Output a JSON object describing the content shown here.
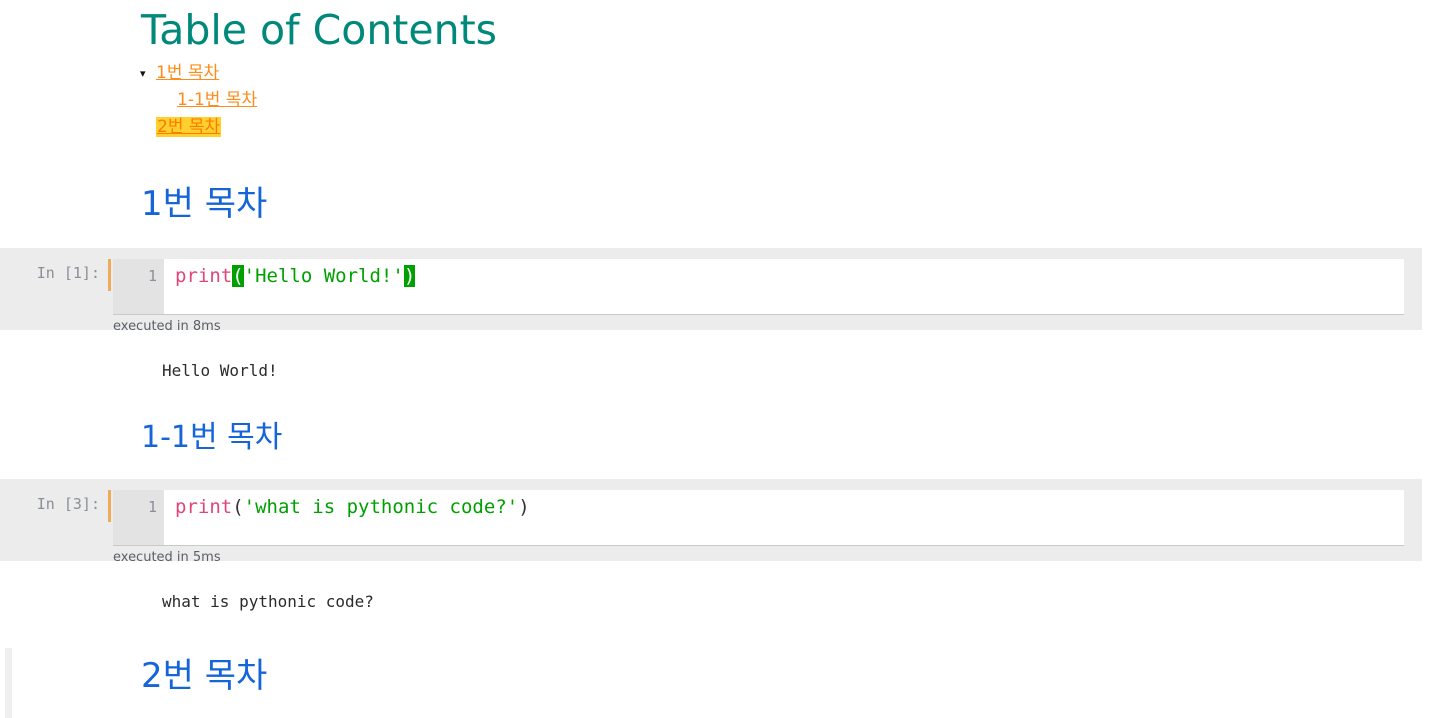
{
  "toc": {
    "title": "Table of Contents",
    "caret_glyph": "▾",
    "items": [
      {
        "label": "1번 목차",
        "level": 1,
        "has_caret": true,
        "highlighted": false
      },
      {
        "label": "1-1번 목차",
        "level": 2,
        "has_caret": false,
        "highlighted": false
      },
      {
        "label": "2번 목차",
        "level": 1,
        "has_caret": false,
        "highlighted": true
      }
    ]
  },
  "sections": [
    {
      "heading": "1번 목차"
    },
    {
      "heading": "1-1번 목차"
    },
    {
      "heading": "2번 목차"
    }
  ],
  "cells": [
    {
      "prompt": "In [1]:",
      "line_number": "1",
      "code_tokens": [
        {
          "text": "print",
          "type": "function"
        },
        {
          "text": "(",
          "type": "bracket-match"
        },
        {
          "text": "'Hello World!'",
          "type": "string"
        },
        {
          "text": ")",
          "type": "bracket-match"
        }
      ],
      "execution_time": "executed in 8ms",
      "output": "Hello World!"
    },
    {
      "prompt": "In [3]:",
      "line_number": "1",
      "code_tokens": [
        {
          "text": "print",
          "type": "function"
        },
        {
          "text": "(",
          "type": "bracket"
        },
        {
          "text": "'what is pythonic code?'",
          "type": "string"
        },
        {
          "text": ")",
          "type": "bracket"
        }
      ],
      "execution_time": "executed in 5ms",
      "output": "what is pythonic code?"
    }
  ],
  "colors": {
    "toc_title": "#00897b",
    "toc_link": "#ff8c1a",
    "toc_highlight_bg": "#ffd02e",
    "heading": "#1565d8",
    "cell_bg": "#ececec",
    "gutter_bg": "#e3e3e3",
    "selected_bar": "#f0ab5a",
    "code_fn": "#e0457b",
    "code_string": "#00a000",
    "bracket_match_bg": "#00a000"
  }
}
